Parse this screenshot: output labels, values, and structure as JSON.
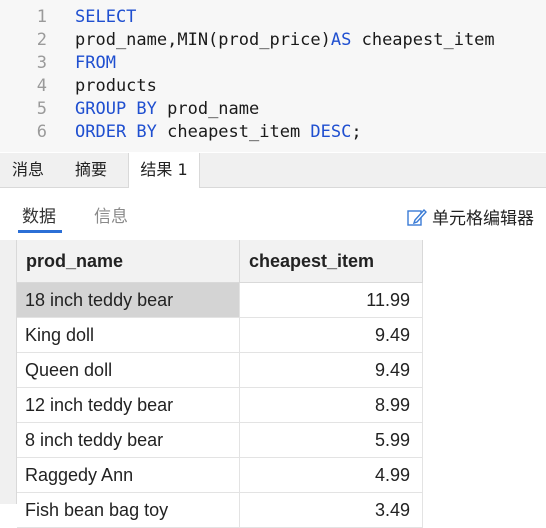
{
  "editor": {
    "lines": [
      {
        "num": "1",
        "parts": [
          {
            "t": "SELECT",
            "k": true
          }
        ]
      },
      {
        "num": "2",
        "parts": [
          {
            "t": "prod_name,MIN(prod_price)",
            "k": false
          },
          {
            "t": "AS",
            "k": true
          },
          {
            "t": " cheapest_item",
            "k": false
          }
        ]
      },
      {
        "num": "3",
        "parts": [
          {
            "t": "FROM",
            "k": true
          }
        ]
      },
      {
        "num": "4",
        "parts": [
          {
            "t": "products",
            "k": false
          }
        ]
      },
      {
        "num": "5",
        "parts": [
          {
            "t": "GROUP BY",
            "k": true
          },
          {
            "t": " prod_name",
            "k": false
          }
        ]
      },
      {
        "num": "6",
        "parts": [
          {
            "t": "ORDER BY",
            "k": true
          },
          {
            "t": " cheapest_item ",
            "k": false
          },
          {
            "t": "DESC",
            "k": true
          },
          {
            "t": ";",
            "k": false
          }
        ]
      }
    ]
  },
  "tabs": [
    {
      "label": "消息"
    },
    {
      "label": "摘要"
    },
    {
      "label": "结果 1",
      "active": true
    }
  ],
  "subtabs": {
    "data_label": "数据",
    "info_label": "信息",
    "cell_editor_label": "单元格编辑器"
  },
  "grid": {
    "columns": [
      "prod_name",
      "cheapest_item"
    ],
    "rows": [
      [
        "18 inch teddy bear",
        "11.99"
      ],
      [
        "King doll",
        "9.49"
      ],
      [
        "Queen doll",
        "9.49"
      ],
      [
        "12 inch teddy bear",
        "8.99"
      ],
      [
        "8 inch teddy bear",
        "5.99"
      ],
      [
        "Raggedy Ann",
        "4.99"
      ],
      [
        "Fish bean bag toy",
        "3.49"
      ]
    ],
    "selected_row": 0
  },
  "colors": {
    "keyword": "#1f4fd0",
    "accent": "#2b6fd6"
  }
}
